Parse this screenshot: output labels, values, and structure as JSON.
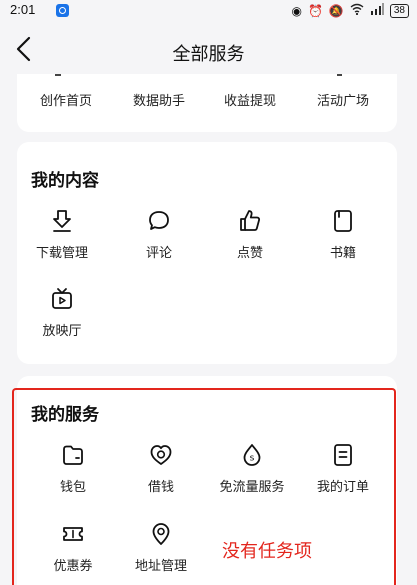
{
  "status_bar": {
    "time": "2:01",
    "battery": "38"
  },
  "header": {
    "title": "全部服务"
  },
  "top_section": {
    "items": [
      {
        "label": "创作首页",
        "icon": "home-icon"
      },
      {
        "label": "数据助手",
        "icon": "chart-icon"
      },
      {
        "label": "收益提现",
        "icon": "wallet-icon"
      },
      {
        "label": "活动广场",
        "icon": "flag-icon"
      }
    ]
  },
  "my_content": {
    "title": "我的内容",
    "items": [
      {
        "label": "下载管理",
        "icon": "download-icon"
      },
      {
        "label": "评论",
        "icon": "comment-icon"
      },
      {
        "label": "点赞",
        "icon": "thumbs-up-icon"
      },
      {
        "label": "书籍",
        "icon": "book-icon"
      },
      {
        "label": "放映厅",
        "icon": "tv-icon"
      }
    ]
  },
  "my_services": {
    "title": "我的服务",
    "items": [
      {
        "label": "钱包",
        "icon": "wallet-icon"
      },
      {
        "label": "借钱",
        "icon": "loan-icon"
      },
      {
        "label": "免流量服务",
        "icon": "data-drop-icon"
      },
      {
        "label": "我的订单",
        "icon": "order-icon"
      },
      {
        "label": "优惠券",
        "icon": "coupon-icon"
      },
      {
        "label": "地址管理",
        "icon": "location-icon"
      }
    ]
  },
  "annotation": {
    "text": "没有任务项",
    "color": "#e3261d"
  }
}
